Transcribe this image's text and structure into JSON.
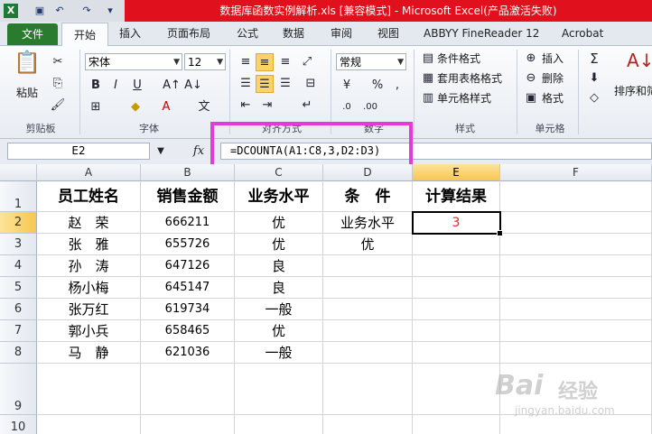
{
  "window": {
    "title": "数据库函数实例解析.xls  [兼容模式] - Microsoft Excel(产品激活失败)"
  },
  "tabs": [
    {
      "label": "文件"
    },
    {
      "label": "开始"
    },
    {
      "label": "插入"
    },
    {
      "label": "页面布局"
    },
    {
      "label": "公式"
    },
    {
      "label": "数据"
    },
    {
      "label": "审阅"
    },
    {
      "label": "视图"
    },
    {
      "label": "ABBYY FineReader 12"
    },
    {
      "label": "Acrobat"
    }
  ],
  "ribbon": {
    "paste_label": "粘贴",
    "font_name": "宋体",
    "font_size": "12",
    "number_format": "常规",
    "bold": "B",
    "italic": "I",
    "underline": "U",
    "conditional_format": "条件格式",
    "table_format": "套用表格格式",
    "cell_style": "单元格样式",
    "insert": "插入",
    "delete": "删除",
    "format": "格式",
    "sort_filter": "排序和筛",
    "groups": {
      "clipboard": "剪贴板",
      "font": "字体",
      "alignment": "对齐方式",
      "number": "数字",
      "styles": "样式",
      "cells": "单元格"
    }
  },
  "formula_bar": {
    "name_box": "E2",
    "formula": "=DCOUNTA(A1:C8,3,D2:D3)"
  },
  "sheet": {
    "columns": [
      "A",
      "B",
      "C",
      "D",
      "E",
      "F"
    ],
    "rows": [
      "1",
      "2",
      "3",
      "4",
      "5",
      "6",
      "7",
      "8",
      "9",
      "10"
    ],
    "headers": [
      "员工姓名",
      "销售金额",
      "业务水平",
      "条　件",
      "计算结果"
    ],
    "data": [
      {
        "name": "赵　荣",
        "amount": "666211",
        "level": "优"
      },
      {
        "name": "张　雅",
        "amount": "655726",
        "level": "优"
      },
      {
        "name": "孙　涛",
        "amount": "647126",
        "level": "良"
      },
      {
        "name": "杨小梅",
        "amount": "645147",
        "level": "良"
      },
      {
        "name": "张万红",
        "amount": "619734",
        "level": "一般"
      },
      {
        "name": "郭小兵",
        "amount": "658465",
        "level": "优"
      },
      {
        "name": "马　静",
        "amount": "621036",
        "level": "一般"
      }
    ],
    "criteria": [
      "业务水平",
      "优"
    ],
    "result": "3"
  },
  "watermark": {
    "brand": "Bai",
    "brand_cn": "经验",
    "url": "jingyan.baidu.com"
  }
}
